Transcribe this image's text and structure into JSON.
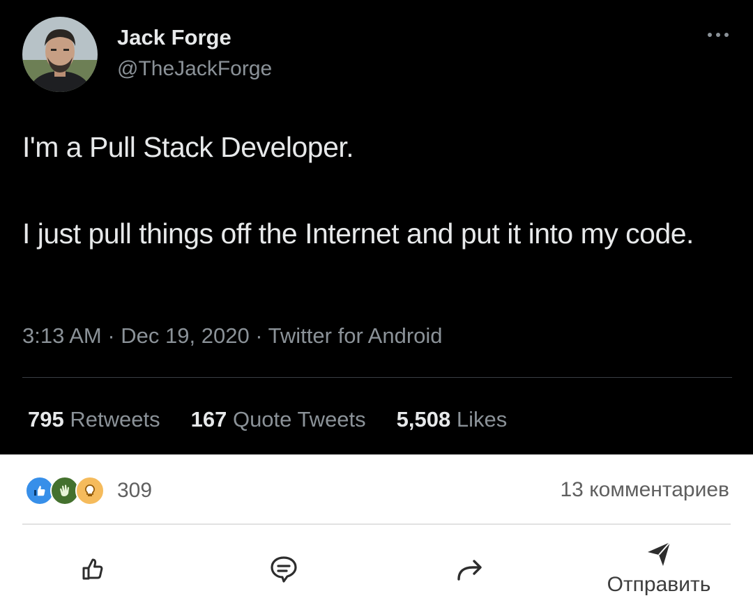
{
  "tweet": {
    "author_name": "Jack Forge",
    "author_handle": "@TheJackForge",
    "text_line1": "I'm a Pull Stack Developer.",
    "text_line2": "I just pull things off the Internet and put it into my code.",
    "meta": "3:13 AM · Dec 19, 2020 · Twitter for Android",
    "stats": {
      "retweets_count": "795",
      "retweets_label": "Retweets",
      "quotes_count": "167",
      "quotes_label": "Quote Tweets",
      "likes_count": "5,508",
      "likes_label": "Likes"
    },
    "more_icon": "ellipsis-icon"
  },
  "post_bar": {
    "reactions": [
      "like-reaction-icon",
      "clap-reaction-icon",
      "insightful-reaction-icon"
    ],
    "reactions_count": "309",
    "comments_label": "13 комментариев",
    "actions": {
      "like_icon": "thumbs-up-icon",
      "comment_icon": "comment-icon",
      "share_icon": "share-arrow-icon",
      "send_icon": "send-icon",
      "send_label": "Отправить"
    }
  },
  "colors": {
    "tweet_bg": "#000000",
    "tweet_text": "#e7e9ea",
    "tweet_muted": "#8b9298",
    "like_blue": "#378fe9",
    "clap_green": "#44712e",
    "insight_yellow": "#f5bb5c"
  }
}
